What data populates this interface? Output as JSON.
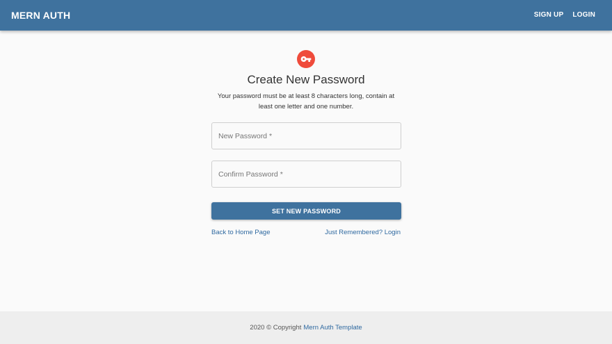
{
  "header": {
    "brand": "MERN AUTH",
    "nav": [
      "SIGN UP",
      "LOGIN"
    ],
    "color": "#3f729e"
  },
  "form": {
    "icon": "key-icon",
    "icon_color": "#ef4b3b",
    "title": "Create New Password",
    "subtitle": "Your password must be at least 8 characters long, contain at least one letter and one number.",
    "new_password": {
      "placeholder": "New Password *",
      "value": ""
    },
    "confirm_password": {
      "placeholder": "Confirm Password *",
      "value": ""
    },
    "submit_label": "SET NEW PASSWORD",
    "back_link": "Back to Home Page",
    "login_link": "Just Remembered? Login"
  },
  "footer": {
    "text": "2020 © Copyright",
    "link": "Mern Auth Template"
  }
}
